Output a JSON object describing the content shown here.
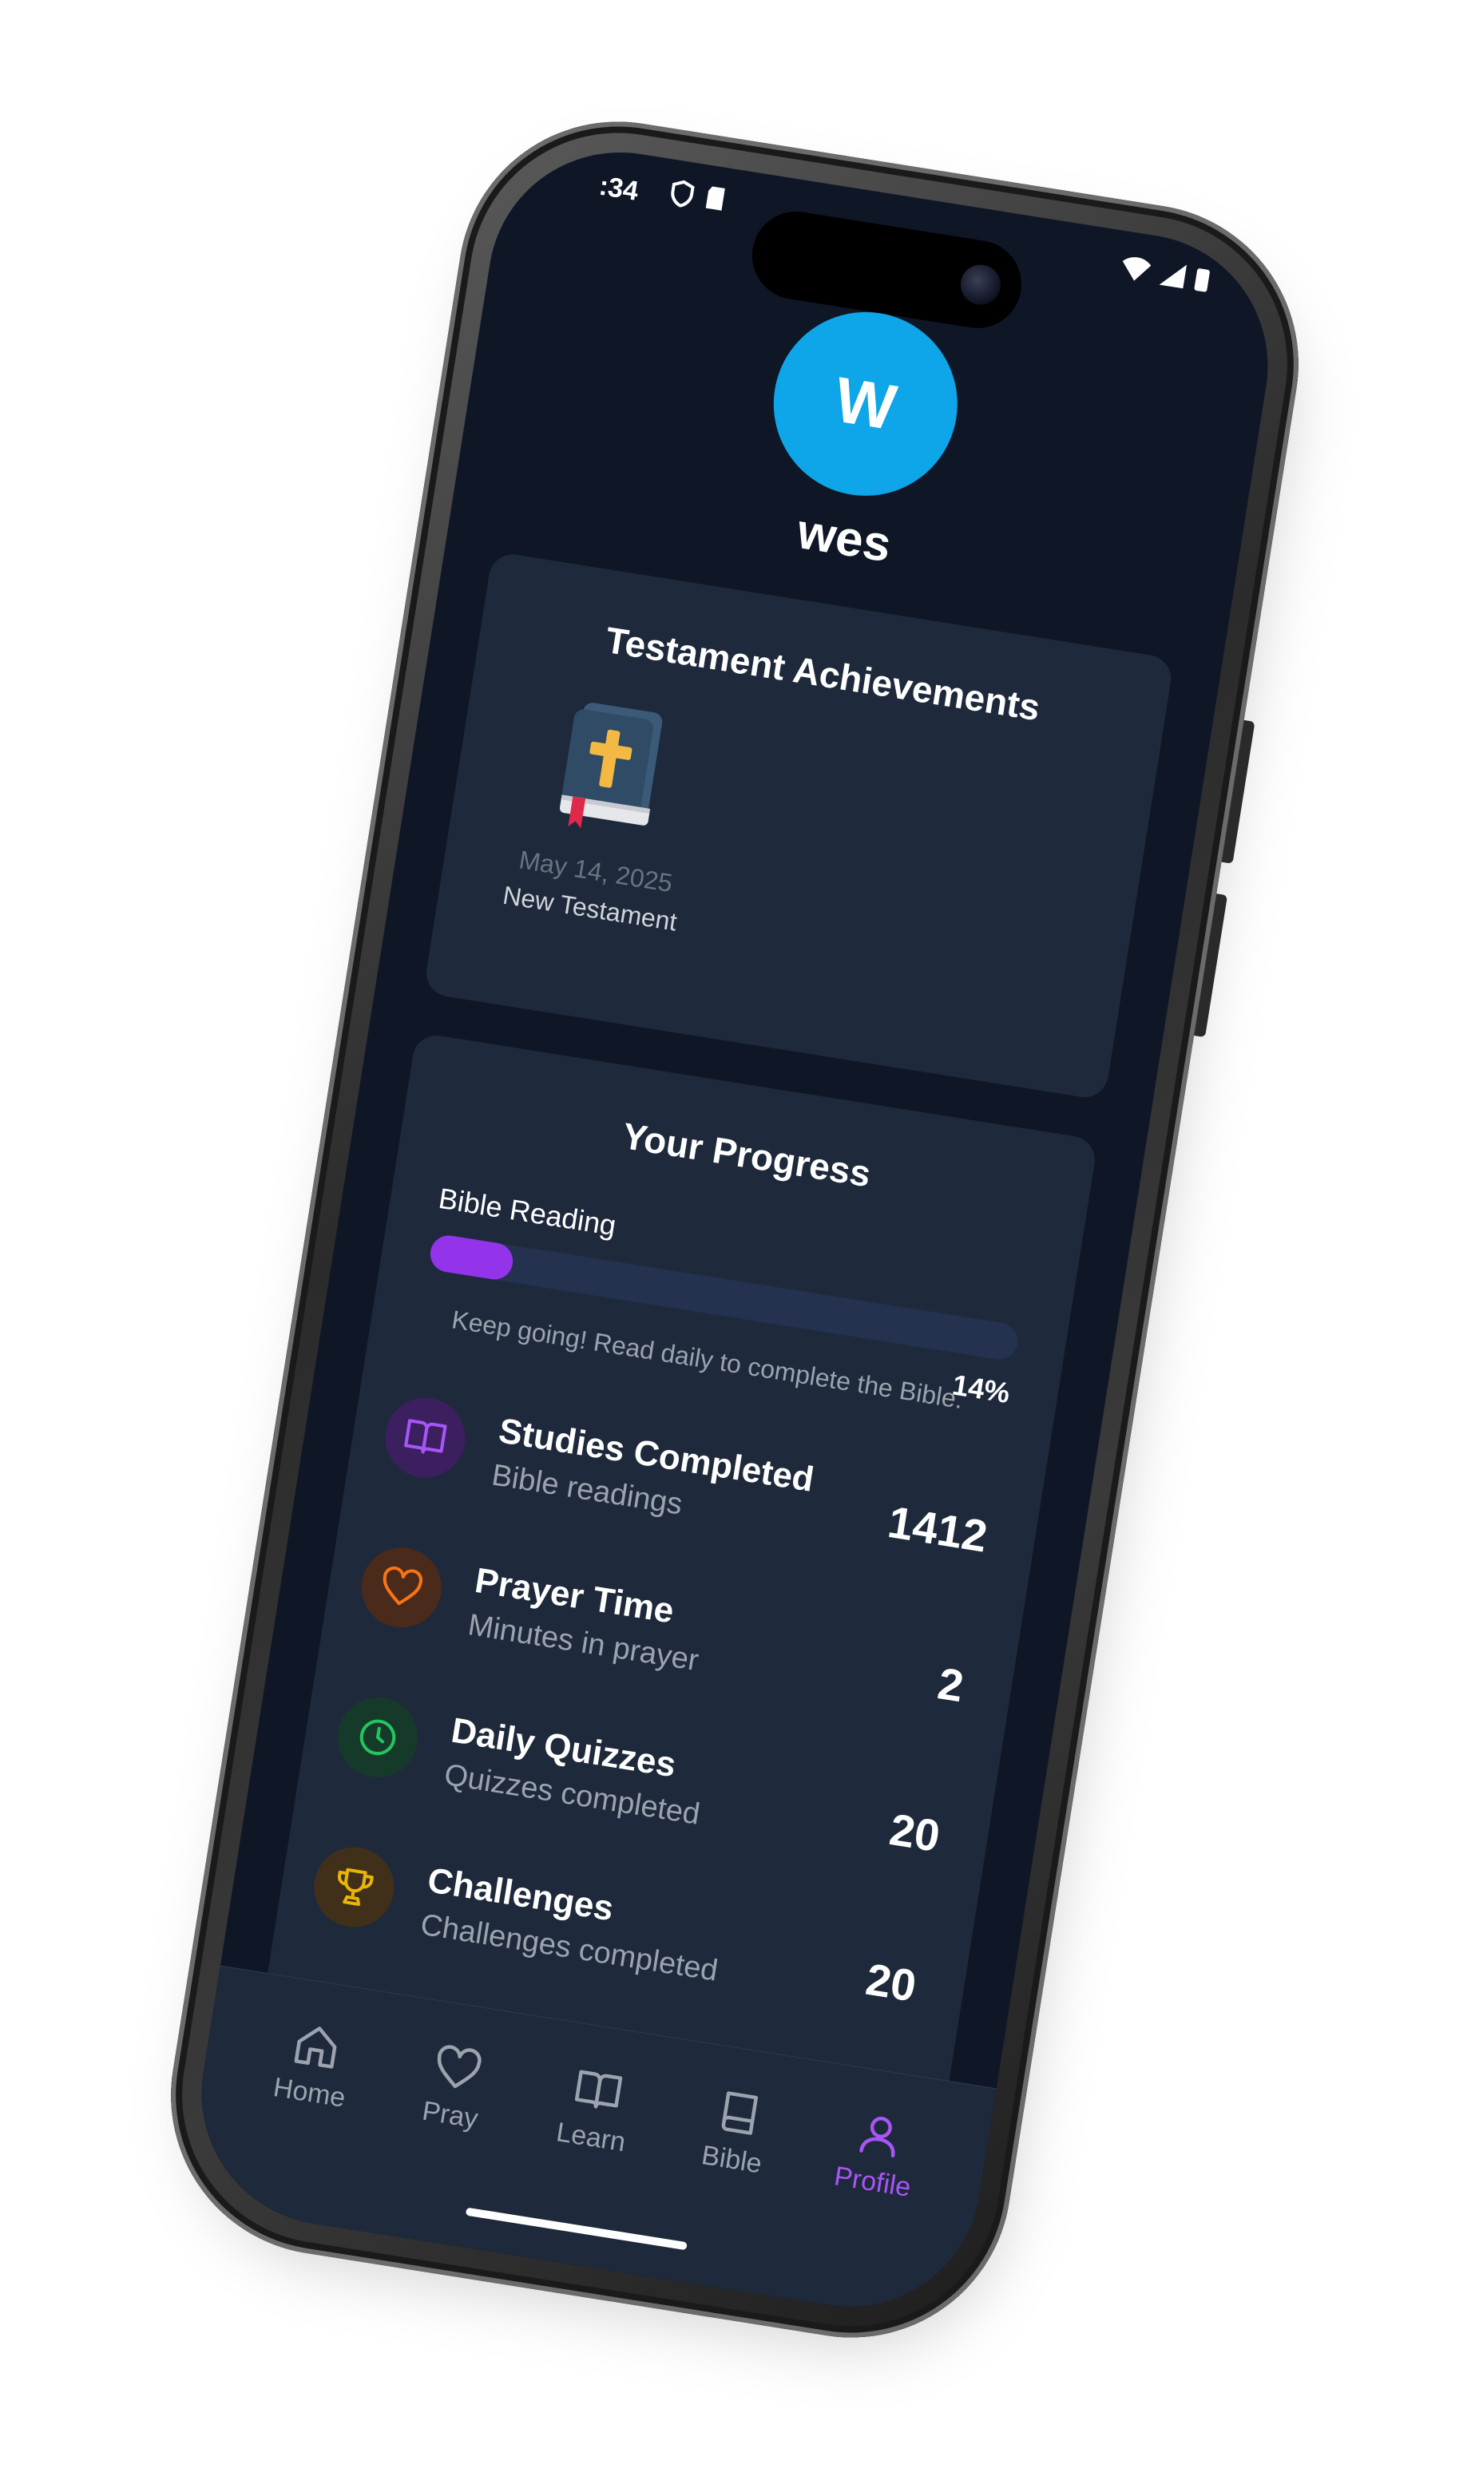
{
  "status": {
    "time": ":34"
  },
  "profile": {
    "avatar_initial": "W",
    "username": "wes"
  },
  "achievements": {
    "title": "Testament Achievements",
    "items": [
      {
        "date": "May 14, 2025",
        "name": "New Testament",
        "icon": "bible-cross-icon"
      }
    ]
  },
  "progress": {
    "title": "Your Progress",
    "reading_label": "Bible Reading",
    "reading_percent": 14,
    "reading_percent_label": "14%",
    "reading_note": "Keep going! Read daily to complete the Bible.",
    "stats": [
      {
        "title": "Studies Completed",
        "subtitle": "Bible readings",
        "value": "1412",
        "icon": "book-open-icon",
        "color": "#a855f7",
        "bg": "#3b1f5e"
      },
      {
        "title": "Prayer Time",
        "subtitle": "Minutes in prayer",
        "value": "2",
        "icon": "heart-icon",
        "color": "#f97316",
        "bg": "#4a2a1a"
      },
      {
        "title": "Daily Quizzes",
        "subtitle": "Quizzes completed",
        "value": "20",
        "icon": "clock-icon",
        "color": "#22c55e",
        "bg": "#163a2a"
      },
      {
        "title": "Challenges",
        "subtitle": "Challenges completed",
        "value": "20",
        "icon": "trophy-icon",
        "color": "#eab308",
        "bg": "#40301a"
      }
    ]
  },
  "nav": {
    "items": [
      {
        "label": "Home",
        "icon": "home-icon",
        "active": false
      },
      {
        "label": "Pray",
        "icon": "heart-icon",
        "active": false
      },
      {
        "label": "Learn",
        "icon": "book-open-icon",
        "active": false
      },
      {
        "label": "Bible",
        "icon": "book-icon",
        "active": false
      },
      {
        "label": "Profile",
        "icon": "user-icon",
        "active": true
      }
    ]
  },
  "colors": {
    "background": "#0f1727",
    "card": "#1e293b",
    "accent": "#9333ea",
    "avatar": "#0ea5e9"
  }
}
